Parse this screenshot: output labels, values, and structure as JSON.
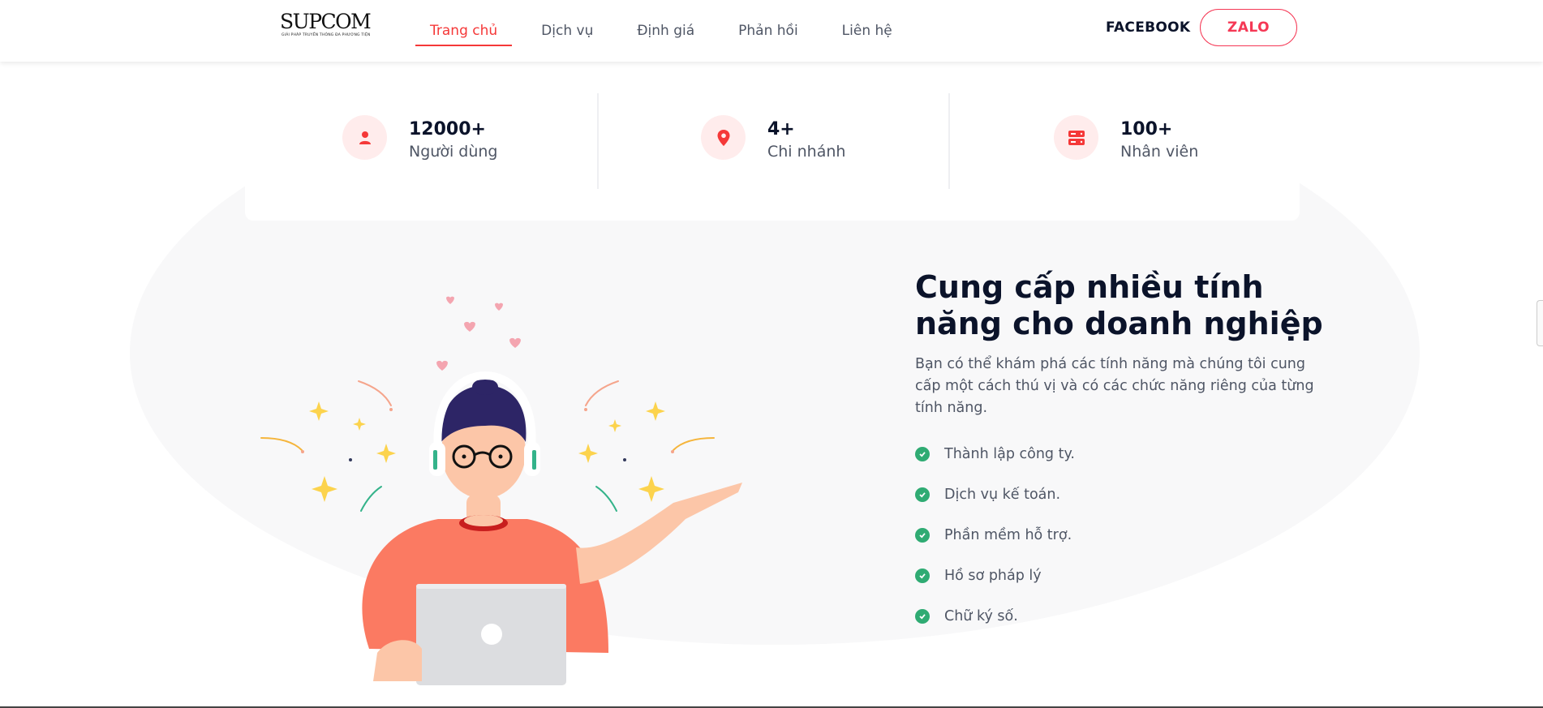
{
  "header": {
    "logo": {
      "brand": "SUPCOM",
      "tagline": "GIẢI PHÁP TRUYỀN THÔNG ĐA PHƯƠNG TIỆN"
    },
    "nav": [
      {
        "label": "Trang chủ",
        "active": true
      },
      {
        "label": "Dịch vụ",
        "active": false
      },
      {
        "label": "Định giá",
        "active": false
      },
      {
        "label": "Phản hồi",
        "active": false
      },
      {
        "label": "Liên hệ",
        "active": false
      }
    ],
    "facebook_label": "FACEBOOK",
    "zalo_label": "ZALO"
  },
  "stats": [
    {
      "value": "12000+",
      "label": "Người dùng",
      "icon": "user-icon"
    },
    {
      "value": "4+",
      "label": "Chi nhánh",
      "icon": "location-pin-icon"
    },
    {
      "value": "100+",
      "label": "Nhân viên",
      "icon": "server-icon"
    }
  ],
  "feature": {
    "title_line1": "Cung cấp nhiều tính",
    "title_line2": "năng cho doanh nghiệp",
    "description": "Bạn có thể khám phá các tính năng mà chúng tôi cung cấp một cách thú vị và có các chức năng riêng của từng tính năng.",
    "items": [
      "Thành lập công ty.",
      "Dịch vụ kế toán.",
      "Phần mềm hỗ trợ.",
      "Hồ sơ pháp lý",
      "Chữ ký số."
    ]
  },
  "colors": {
    "accent": "#f53838",
    "check": "#2fab73",
    "heading": "#0b132a",
    "text": "#4f5665"
  }
}
